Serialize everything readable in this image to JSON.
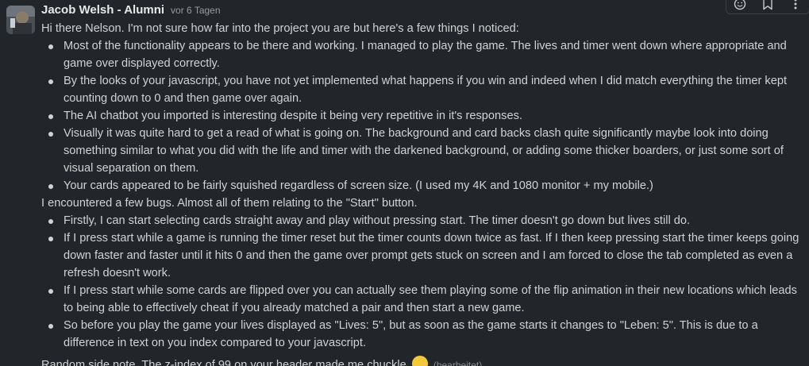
{
  "message": {
    "author": "Jacob Welsh - Alumni",
    "timestamp": "vor 6 Tagen",
    "intro": "Hi there Nelson. I'm not sure how far into the project you are but here's a few things I noticed:",
    "observations": [
      "Most of the functionality appears to be there and working. I managed to play the game. The lives and timer went down where appropriate and game over displayed correctly.",
      "By the looks of your javascript, you have not yet implemented what happens if you win and indeed when I did match everything the timer kept counting down to 0 and then game over again.",
      "The AI chatbot you imported is interesting despite it being very repetitive in it's responses.",
      "Visually it was quite hard to get a read of what is going on. The background and card backs clash quite significantly maybe look into doing something similar to what you did with the life and timer with the darkened background, or adding some thicker boarders, or just some sort of visual separation on them.",
      "Your cards appeared to be fairly squished regardless of screen size. (I used my 4K and 1080 monitor + my mobile.)"
    ],
    "bugs_intro": "I encountered a few bugs. Almost all of them relating to the \"Start\" button.",
    "bugs": [
      "Firstly, I can start selecting cards straight away and play without pressing start. The timer doesn't go down but lives still do.",
      "If I press start while a game is running the timer reset but the timer counts down twice as fast. If I then keep pressing start the timer keeps going down faster and faster until it hits 0 and then the game over prompt gets stuck on screen and I am forced to close the tab completed as even a refresh doesn't work.",
      "If I press start while some cards are flipped over you can actually see them playing some of the flip animation in their new locations which leads to being able to effectively cheat if you already matched a pair and then start a new game.",
      "So before you play the game your lives displayed as \"Lives: 5\", but as soon as the game starts it changes to \"Leben: 5\". This is due to a difference in text on you index compared to your javascript."
    ],
    "side_note": "Random side note. The z-index of 99 on your header made me chuckle",
    "edited_label": "(bearbeitet)"
  },
  "toolbar": {
    "icons": [
      "add-reaction-icon",
      "bookmark-icon",
      "more-actions-icon"
    ]
  },
  "colors": {
    "background": "#222529",
    "text": "#d1d2d3",
    "muted": "#9a9b9e",
    "emoji": "#f3c93a"
  }
}
